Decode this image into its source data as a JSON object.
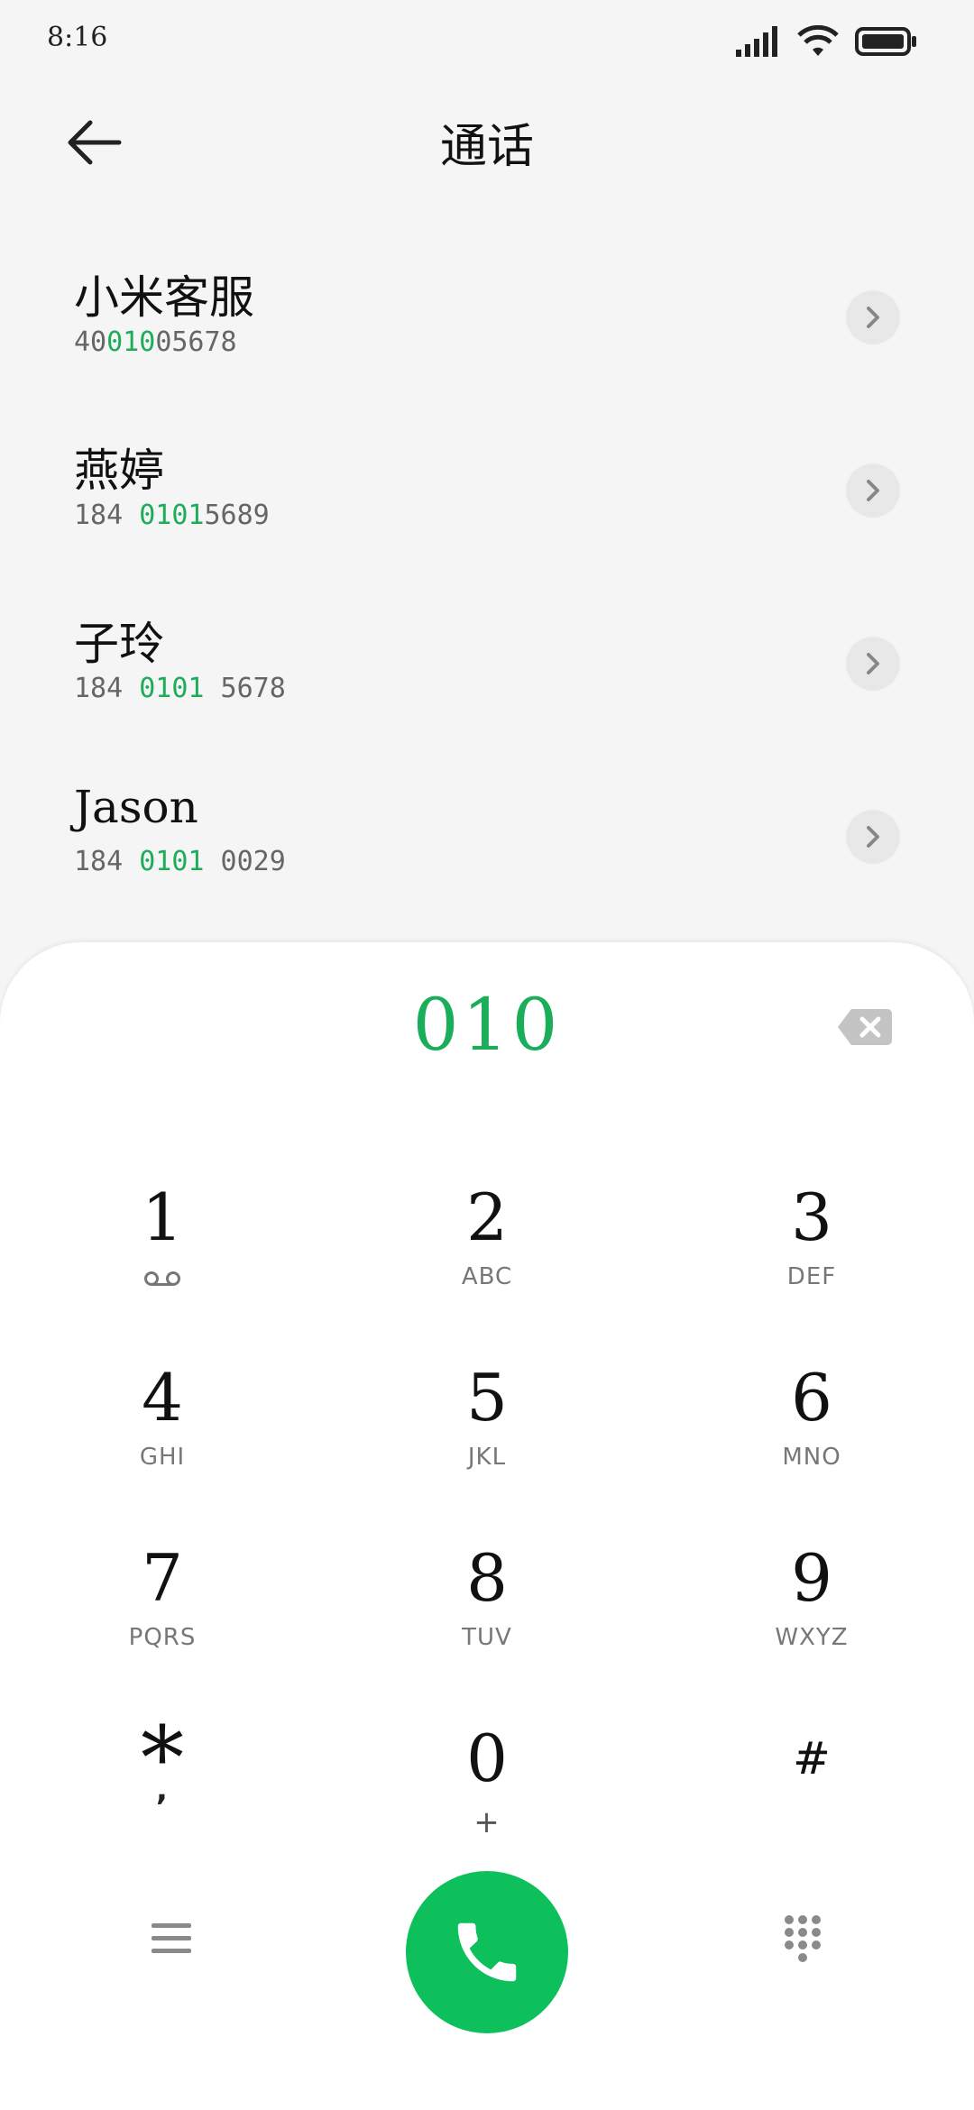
{
  "status": {
    "time": "8:16",
    "icons": [
      "signal-icon",
      "wifi-icon",
      "battery-icon"
    ]
  },
  "header": {
    "title": "通话",
    "back_icon": "arrow-left-icon"
  },
  "contacts": [
    {
      "name": "小米客服",
      "number_pre": "40",
      "number_hl": "010",
      "number_post": "05678"
    },
    {
      "name": "燕婷",
      "number_pre": "184 ",
      "number_hl": "0101",
      "number_post": "5689"
    },
    {
      "name": "子玲",
      "number_pre": "184 ",
      "number_hl": "0101",
      "number_post": " 5678"
    },
    {
      "name": "Jason",
      "number_pre": "184 ",
      "number_hl": "0101",
      "number_post": " 0029"
    }
  ],
  "dialer": {
    "input": "010",
    "keys": [
      {
        "digit": "1",
        "letters": ""
      },
      {
        "digit": "2",
        "letters": "ABC"
      },
      {
        "digit": "3",
        "letters": "DEF"
      },
      {
        "digit": "4",
        "letters": "GHI"
      },
      {
        "digit": "5",
        "letters": "JKL"
      },
      {
        "digit": "6",
        "letters": "MNO"
      },
      {
        "digit": "7",
        "letters": "PQRS"
      },
      {
        "digit": "8",
        "letters": "TUV"
      },
      {
        "digit": "9",
        "letters": "WXYZ"
      },
      {
        "digit": "*",
        "letters": ","
      },
      {
        "digit": "0",
        "letters": "+"
      },
      {
        "digit": "#",
        "letters": ""
      }
    ]
  },
  "colors": {
    "accent": "#1aad5a",
    "call_button": "#0ec05c",
    "background": "#f5f5f5"
  }
}
